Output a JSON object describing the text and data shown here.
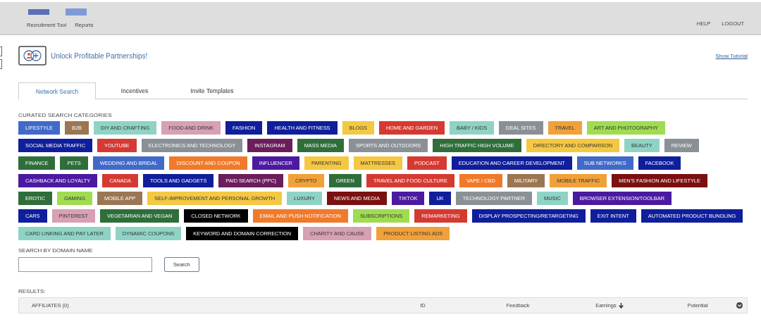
{
  "header": {
    "nav": [
      "Recruitment Tool",
      "Reports"
    ],
    "actions": [
      "HELP",
      "LOGOUT"
    ]
  },
  "title": "Unlock Profitable Partnerships!",
  "tutorial_link": "Show Tutorial",
  "tabs": [
    {
      "label": "Network Search",
      "selected": true
    },
    {
      "label": "Incentives",
      "selected": false
    },
    {
      "label": "Invite Templates",
      "selected": false
    }
  ],
  "categories": {
    "heading": "CURATED SEARCH CATEGORIES",
    "rows": [
      {
        "tags": [
          {
            "label": "LIFESTYLE",
            "color": "#4169c8"
          },
          {
            "label": "B2B",
            "color": "#9b7653"
          },
          {
            "label": "DIY AND CRAFTING",
            "color": "#8fd3c5"
          },
          {
            "label": "FOOD AND DRINK",
            "color": "#d7a0b4"
          },
          {
            "label": "FASHION",
            "color": "#0f1e9a"
          },
          {
            "label": "HEALTH AND FITNESS",
            "color": "#0f1e9a"
          },
          {
            "label": "BLOGS",
            "color": "#f4c842"
          },
          {
            "label": "HOME AND GARDEN",
            "color": "#d43a32"
          },
          {
            "label": "BABY / KIDS",
            "color": "#8fd3c5"
          },
          {
            "label": "DEAL SITES",
            "color": "#8a9096"
          },
          {
            "label": "TRAVEL",
            "color": "#f0a13a"
          },
          {
            "label": "ART AND PHOTOGRAPHY",
            "color": "#9fdc50"
          }
        ]
      },
      {
        "tags": [
          {
            "label": "SOCIAL MEDIA TRAFFIC",
            "color": "#0f1e9a"
          },
          {
            "label": "YOUTUBE",
            "color": "#d43a32"
          },
          {
            "label": "ELECTRONICS AND TECHNOLOGY",
            "color": "#8a9096"
          },
          {
            "label": "INSTAGRAM",
            "color": "#6b1d5c"
          },
          {
            "label": "MASS MEDIA",
            "color": "#2f6e3a"
          },
          {
            "label": "SPORTS AND OUTDOORS",
            "color": "#8a9096"
          },
          {
            "label": "HIGH TRAFFIC HIGH VOLUME",
            "color": "#2f6e3a"
          },
          {
            "label": "DIRECTORY AND COMPARISON",
            "color": "#f4c842"
          },
          {
            "label": "BEAUTY",
            "color": "#8fd3c5"
          },
          {
            "label": "REVIEW",
            "color": "#8a9096"
          }
        ]
      },
      {
        "tags": [
          {
            "label": "FINANCE",
            "color": "#2f6e3a"
          },
          {
            "label": "PETS",
            "color": "#2f6e3a"
          },
          {
            "label": "WEDDING AND BRIDAL",
            "color": "#4169c8"
          },
          {
            "label": "DISCOUNT AND COUPON",
            "color": "#f07a2a"
          },
          {
            "label": "INFLUENCER",
            "color": "#4b1aa0"
          },
          {
            "label": "PARENTING",
            "color": "#f4c842"
          },
          {
            "label": "MATTRESSES",
            "color": "#f4c842"
          },
          {
            "label": "PODCAST",
            "color": "#d43a32"
          },
          {
            "label": "EDUCATION AND CAREER DEVELOPMENT",
            "color": "#0f1e9a"
          },
          {
            "label": "SUB NETWORKS",
            "color": "#4169c8"
          },
          {
            "label": "FACEBOOK",
            "color": "#0f1e9a"
          }
        ]
      },
      {
        "tags": [
          {
            "label": "CASHBACK AND LOYALTY",
            "color": "#4b1aa0"
          },
          {
            "label": "CANADA",
            "color": "#d43a32"
          },
          {
            "label": "TOOLS AND GADGETS",
            "color": "#0f1e9a"
          },
          {
            "label": "PAID SEARCH (PPC)",
            "color": "#6b1d5c"
          },
          {
            "label": "CRYPTO",
            "color": "#f0a13a"
          },
          {
            "label": "GREEN",
            "color": "#2f6e3a"
          },
          {
            "label": "TRAVEL AND FOOD CULTURE",
            "color": "#d43a32"
          },
          {
            "label": "VAPE / CBD",
            "color": "#f07a2a"
          },
          {
            "label": "MILITARY",
            "color": "#9b7653"
          },
          {
            "label": "MOBILE TRAFFIC",
            "color": "#f0a13a"
          },
          {
            "label": "MEN'S FASHION AND LIFESTYLE",
            "color": "#7a1010"
          }
        ]
      },
      {
        "tags": [
          {
            "label": "EROTIC",
            "color": "#2f6e3a"
          },
          {
            "label": "GAMING",
            "color": "#9fdc50"
          },
          {
            "label": "MOBILE APP",
            "color": "#9b7653"
          },
          {
            "label": "SELF-IMPROVEMENT AND PERSONAL GROWTH",
            "color": "#f4c842"
          },
          {
            "label": "LUXURY",
            "color": "#8fd3c5"
          },
          {
            "label": "NEWS AND MEDIA",
            "color": "#7a1010"
          },
          {
            "label": "TIKTOK",
            "color": "#4b1aa0"
          },
          {
            "label": "UK",
            "color": "#0f1e9a"
          },
          {
            "label": "TECHNOLOGY PARTNER",
            "color": "#8a9096"
          },
          {
            "label": "MUSIC",
            "color": "#8fd3c5"
          },
          {
            "label": "BROWSER EXTENSION/TOOLBAR",
            "color": "#4b1aa0"
          }
        ]
      },
      {
        "tags": [
          {
            "label": "CARS",
            "color": "#0f1e9a"
          },
          {
            "label": "PINTEREST",
            "color": "#d7a0b4"
          },
          {
            "label": "VEGETARIAN AND VEGAN",
            "color": "#2f6e3a"
          },
          {
            "label": "CLOSED NETWORK",
            "color": "#000000"
          },
          {
            "label": "EMAIL AND PUSH NOTIFICATION",
            "color": "#f07a2a"
          },
          {
            "label": "SUBSCRIPTIONS",
            "color": "#9fdc50"
          },
          {
            "label": "REMARKETING",
            "color": "#d43a32"
          },
          {
            "label": "DISPLAY PROSPECTING/RETARGETING",
            "color": "#0f1e9a"
          },
          {
            "label": "EXIT INTENT",
            "color": "#0f1e9a"
          },
          {
            "label": "AUTOMATED PRODUCT BUNDLING",
            "color": "#0f1e9a"
          }
        ]
      },
      {
        "tags": [
          {
            "label": "CARD LINKING AND PAY LATER",
            "color": "#8fd3c5"
          },
          {
            "label": "DYNAMIC COUPONS",
            "color": "#8fd3c5"
          },
          {
            "label": "KEYWORD AND DOMAIN CORRECTION",
            "color": "#000000"
          },
          {
            "label": "CHARITY AND CAUSE",
            "color": "#d7a0b4"
          },
          {
            "label": "PRODUCT LISTING ADS",
            "color": "#f0a13a"
          }
        ]
      }
    ]
  },
  "domain_search": {
    "label": "SEARCH BY DOMAIN NAME",
    "button": "Search"
  },
  "results": {
    "label": "RESULTS:",
    "columns": [
      {
        "label": "AFFILIATES (0)",
        "sorted": false
      },
      {
        "label": "ID",
        "sorted": false
      },
      {
        "label": "Feedback",
        "sorted": false
      },
      {
        "label": "Earnings",
        "sorted": true
      },
      {
        "label": "Potential",
        "sorted": false
      }
    ]
  }
}
